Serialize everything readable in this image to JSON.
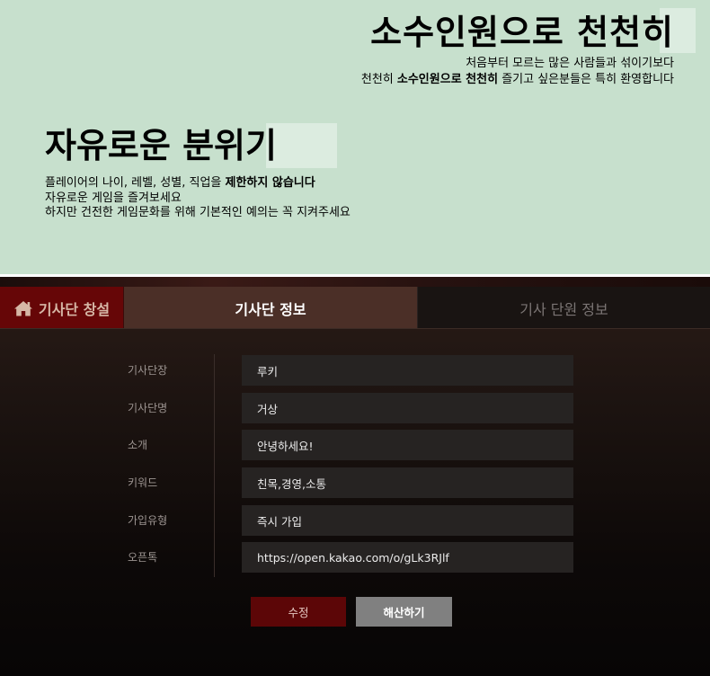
{
  "intro": {
    "right": {
      "title": "소수인원으로 천천히",
      "line1": "처음부터 모르는 많은 사람들과 섞이기보다",
      "line2_pre": "천천히 ",
      "line2_bold": "소수인원으로 천천히",
      "line2_post": " 즐기고 싶은분들은 특히 환영합니다"
    },
    "left": {
      "title": "자유로운 분위기",
      "line1_pre": "플레이어의 나이, 레벨, 성별, 직업을 ",
      "line1_bold": "제한하지 않습니다",
      "line2": "자유로운 게임을 즐겨보세요",
      "line3": "하지만 건전한 게임문화를 위해 기본적인 예의는 꼭 지켜주세요"
    }
  },
  "tabs": {
    "create": "기사단 창설",
    "info": "기사단 정보",
    "members": "기사 단원 정보"
  },
  "form": {
    "rows": [
      {
        "label": "기사단장",
        "value": "루키"
      },
      {
        "label": "기사단명",
        "value": "거상"
      },
      {
        "label": "소개",
        "value": "안녕하세요!"
      },
      {
        "label": "키워드",
        "value": "친목,경영,소통"
      },
      {
        "label": "가입유형",
        "value": "즉시 가입"
      },
      {
        "label": "오픈톡",
        "value": "https://open.kakao.com/o/gLk3RJlf"
      }
    ]
  },
  "buttons": {
    "edit": "수정",
    "disband": "해산하기"
  },
  "colors": {
    "intro_bg": "#c7e0cd",
    "tab_create": "#660607",
    "tab_active": "#4b2f27",
    "tab_inactive": "#191412",
    "field_bg": "#262322",
    "edit_button": "#5c0607",
    "disband_button": "#808080"
  },
  "icons": {
    "create_tab": "home-icon"
  }
}
